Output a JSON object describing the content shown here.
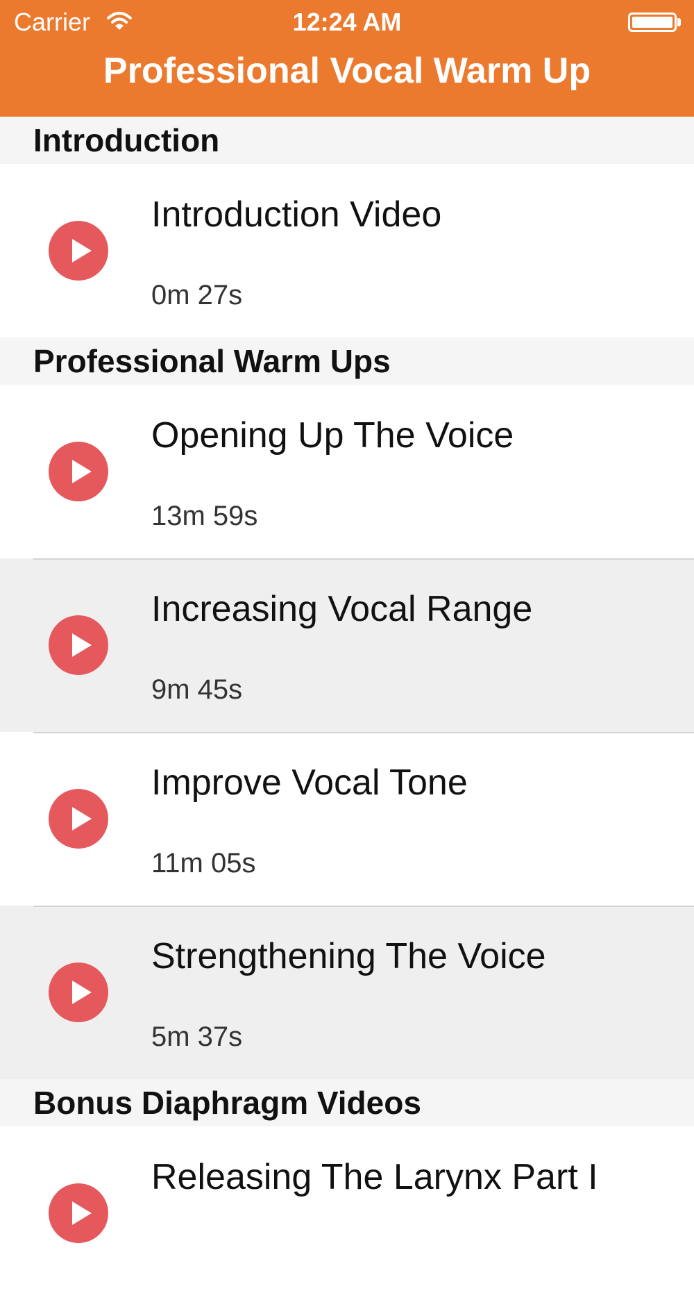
{
  "status_bar": {
    "carrier": "Carrier",
    "time": "12:24 AM",
    "wifi_icon": "wifi-icon",
    "battery_icon": "battery-icon"
  },
  "nav": {
    "title": "Professional Vocal Warm Up"
  },
  "colors": {
    "accent": "#ec7a2e",
    "play_button": "#e5585c",
    "section_bg": "#f5f5f5",
    "row_alt_bg": "#efefef"
  },
  "sections": [
    {
      "title": "Introduction",
      "items": [
        {
          "title": "Introduction Video",
          "duration": "0m 27s",
          "icon": "play-icon"
        }
      ]
    },
    {
      "title": "Professional Warm Ups",
      "items": [
        {
          "title": "Opening Up The Voice",
          "duration": "13m 59s",
          "icon": "play-icon"
        },
        {
          "title": "Increasing Vocal Range",
          "duration": "9m 45s",
          "icon": "play-icon"
        },
        {
          "title": "Improve Vocal Tone",
          "duration": "11m 05s",
          "icon": "play-icon"
        },
        {
          "title": "Strengthening The Voice",
          "duration": "5m 37s",
          "icon": "play-icon"
        }
      ]
    },
    {
      "title": "Bonus Diaphragm Videos",
      "items": [
        {
          "title": "Releasing The Larynx Part I",
          "duration": "",
          "icon": "play-icon"
        }
      ]
    }
  ]
}
